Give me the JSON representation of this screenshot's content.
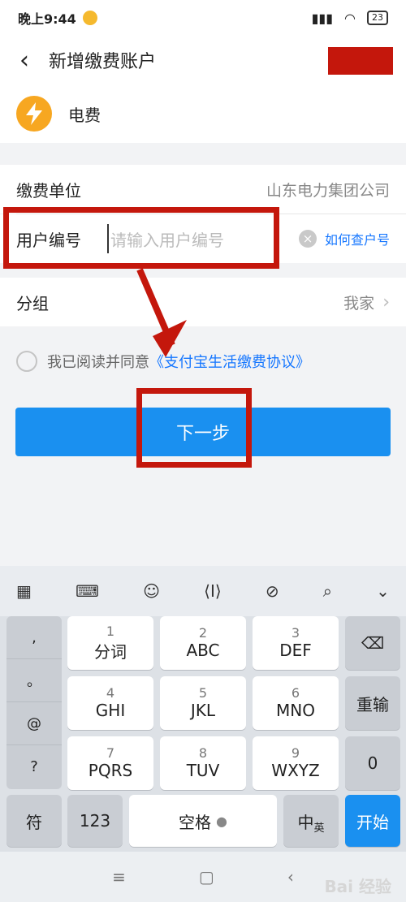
{
  "status_bar": {
    "time": "晚上9:44",
    "battery": "23"
  },
  "header": {
    "title": "新增缴费账户"
  },
  "type": {
    "label": "电费"
  },
  "form": {
    "unit_label": "缴费单位",
    "unit_value": "山东电力集团公司",
    "user_label": "用户编号",
    "user_placeholder": "请输入用户编号",
    "how_to_link": "如何查户号",
    "group_label": "分组",
    "group_value": "我家"
  },
  "agreement": {
    "text": "我已阅读并同意",
    "link": "《支付宝生活缴费协议》"
  },
  "next_button": "下一步",
  "keyboard": {
    "side_symbols": [
      ",",
      "。",
      "@",
      "?"
    ],
    "keys": [
      {
        "num": "1",
        "label": "分词"
      },
      {
        "num": "2",
        "label": "ABC"
      },
      {
        "num": "3",
        "label": "DEF"
      },
      {
        "num": "4",
        "label": "GHI"
      },
      {
        "num": "5",
        "label": "JKL"
      },
      {
        "num": "6",
        "label": "MNO"
      },
      {
        "num": "7",
        "label": "PQRS"
      },
      {
        "num": "8",
        "label": "TUV"
      },
      {
        "num": "9",
        "label": "WXYZ"
      }
    ],
    "reenter": "重输",
    "zero": "0",
    "symbol": "符",
    "num123": "123",
    "space": "空格",
    "lang_main": "中",
    "lang_sub": "英",
    "go": "开始"
  },
  "watermark": "Bai 经验",
  "colors": {
    "accent": "#1a90f0",
    "link": "#1677ff",
    "annotation": "#c4170c",
    "bolt": "#f7a721"
  }
}
